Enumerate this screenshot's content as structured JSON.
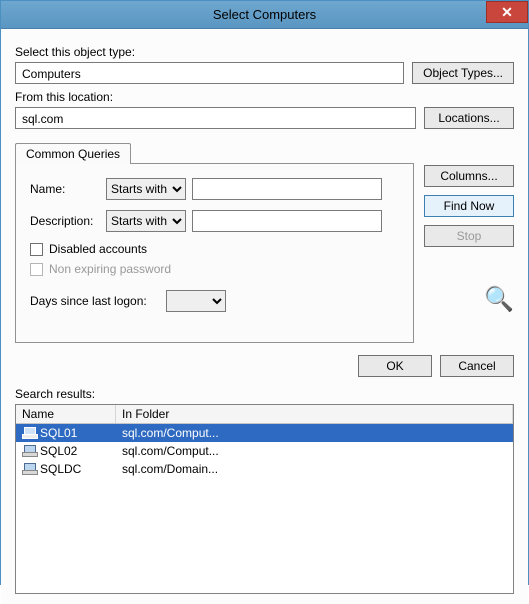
{
  "titlebar": {
    "title": "Select Computers"
  },
  "sections": {
    "objectType": {
      "label": "Select this object type:",
      "value": "Computers",
      "button": "Object Types..."
    },
    "fromLocation": {
      "label": "From this location:",
      "value": "sql.com",
      "button": "Locations..."
    }
  },
  "queries": {
    "tab": "Common Queries",
    "name_label": "Name:",
    "desc_label": "Description:",
    "name_op": "Starts with",
    "desc_op": "Starts with",
    "name_val": "",
    "desc_val": "",
    "disabled_accounts": "Disabled accounts",
    "non_expiring": "Non expiring password",
    "days_label": "Days since last logon:"
  },
  "rightButtons": {
    "columns": "Columns...",
    "findnow": "Find Now",
    "stop": "Stop"
  },
  "dialogButtons": {
    "ok": "OK",
    "cancel": "Cancel"
  },
  "results": {
    "label": "Search results:",
    "columns": {
      "name": "Name",
      "folder": "In Folder"
    },
    "rows": [
      {
        "name": "SQL01",
        "folder": "sql.com/Comput...",
        "selected": true
      },
      {
        "name": "SQL02",
        "folder": "sql.com/Comput...",
        "selected": false
      },
      {
        "name": "SQLDC",
        "folder": "sql.com/Domain...",
        "selected": false
      }
    ]
  }
}
